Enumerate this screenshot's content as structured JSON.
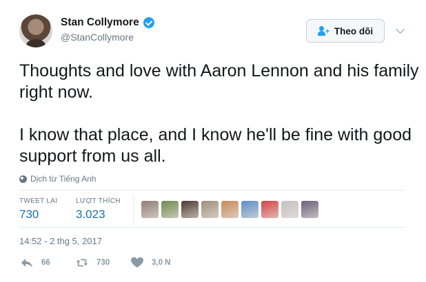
{
  "user": {
    "display_name": "Stan Collymore",
    "handle": "@StanCollymore",
    "verified": true
  },
  "follow_button": {
    "label": "Theo dõi"
  },
  "tweet": {
    "paragraphs": [
      "Thoughts and love with Aaron Lennon and his family right now.",
      "I know that place, and I know he'll be fine with good support from us all."
    ],
    "translate_label": "Dịch từ Tiếng Anh"
  },
  "stats": {
    "retweets": {
      "label": "TWEET LẠI",
      "value": "730"
    },
    "likes": {
      "label": "LƯỢT THÍCH",
      "value": "3.023"
    },
    "liker_avatar_colors": [
      "#8f7d78",
      "#6d8a4f",
      "#4b3a30",
      "#a08f7d",
      "#c88a5a",
      "#5a8fc7",
      "#d14545",
      "#c6c2c2",
      "#6b5f7a"
    ]
  },
  "timestamp": "14:52 - 2 thg 5, 2017",
  "actions": {
    "reply_count": "66",
    "retweet_count": "730",
    "like_count": "3,0 N"
  },
  "colors": {
    "accent": "#1da1f2",
    "stat_value": "#1b6fa8",
    "muted": "#657786"
  }
}
